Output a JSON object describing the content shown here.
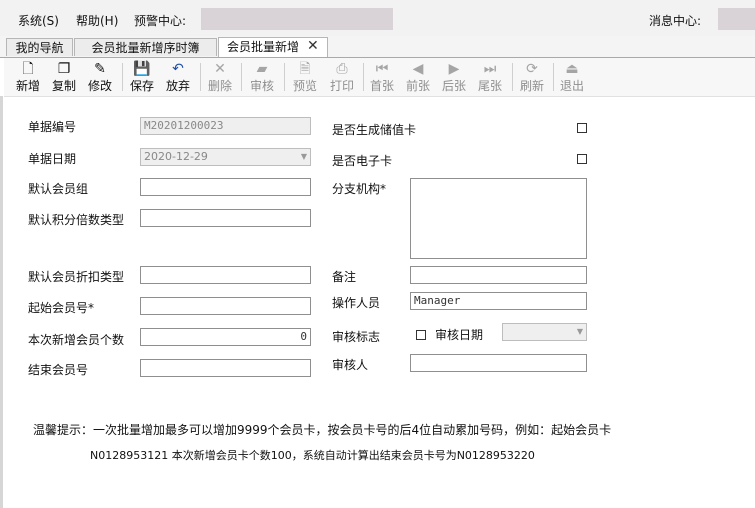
{
  "menubar": {
    "system": "系统(S)",
    "help": "帮助(H)",
    "alert_center": "预警中心:",
    "message_center": "消息中心:"
  },
  "tabs": [
    {
      "label": "我的导航"
    },
    {
      "label": "会员批量新增序时簿"
    },
    {
      "label": "会员批量新增"
    }
  ],
  "toolbar": {
    "new": "新增",
    "copy": "复制",
    "modify": "修改",
    "save": "保存",
    "discard": "放弃",
    "delete": "删除",
    "audit": "审核",
    "preview": "预览",
    "print": "打印",
    "first": "首张",
    "prev": "前张",
    "next": "后张",
    "last": "尾张",
    "refresh": "刷新",
    "exit": "退出"
  },
  "form": {
    "doc_no_label": "单据编号",
    "doc_no_value": "M20201200023",
    "doc_date_label": "单据日期",
    "doc_date_value": "2020-12-29",
    "default_group_label": "默认会员组",
    "default_points_label": "默认积分倍数类型",
    "default_discount_label": "默认会员折扣类型",
    "start_no_label": "起始会员号*",
    "count_label": "本次新增会员个数",
    "count_value": "0",
    "end_no_label": "结束会员号",
    "gen_stored_label": "是否生成储值卡",
    "ecard_label": "是否电子卡",
    "branch_label": "分支机构*",
    "remark_label": "备注",
    "operator_label": "操作人员",
    "operator_value": "Manager",
    "audit_flag_label": "审核标志",
    "audit_date_label": "审核日期",
    "auditor_label": "审核人"
  },
  "tip": {
    "line1": "温馨提示：一次批量增加最多可以增加9999个会员卡，按会员卡号的后4位自动累加号码，例如：起始会员卡",
    "line2": "N0128953121 本次新增会员卡个数100，系统自动计算出结束会员卡号为N0128953220"
  }
}
